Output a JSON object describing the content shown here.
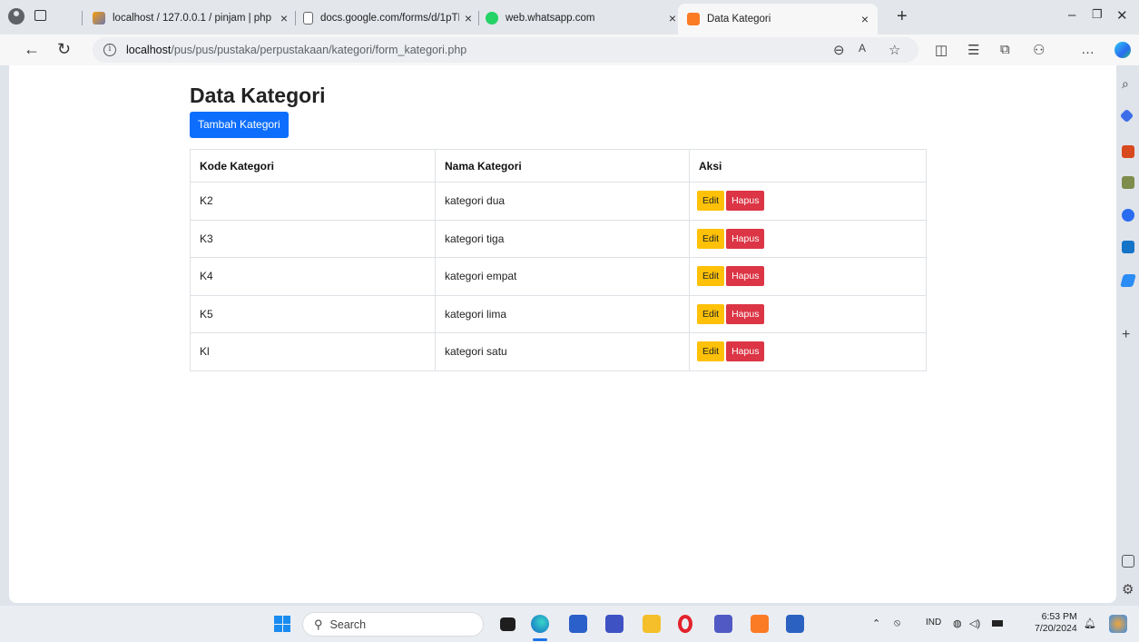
{
  "browser": {
    "tabs": [
      {
        "title": "localhost / 127.0.0.1 / pinjam | php"
      },
      {
        "title": "docs.google.com/forms/d/1pTNC"
      },
      {
        "title": "web.whatsapp.com"
      },
      {
        "title": "Data Kategori",
        "active": true
      }
    ],
    "url_host": "localhost",
    "url_path": "/pus/pus/pustaka/perpustakaan/kategori/form_kategori.php"
  },
  "page": {
    "title": "Data Kategori",
    "add_button": "Tambah Kategori",
    "table": {
      "headers": [
        "Kode Kategori",
        "Nama Kategori",
        "Aksi"
      ],
      "rows": [
        {
          "kode": "K2",
          "nama": "kategori dua"
        },
        {
          "kode": "K3",
          "nama": "kategori tiga"
        },
        {
          "kode": "K4",
          "nama": "kategori empat"
        },
        {
          "kode": "K5",
          "nama": "kategori lima"
        },
        {
          "kode": "Kl",
          "nama": "kategori satu"
        }
      ],
      "edit_label": "Edit",
      "delete_label": "Hapus"
    }
  },
  "taskbar": {
    "search_placeholder": "Search",
    "language": "IND",
    "time": "6:53 PM",
    "date": "7/20/2024"
  },
  "colors": {
    "primary": "#0d6efd",
    "warning": "#ffc107",
    "danger": "#dc3545"
  }
}
